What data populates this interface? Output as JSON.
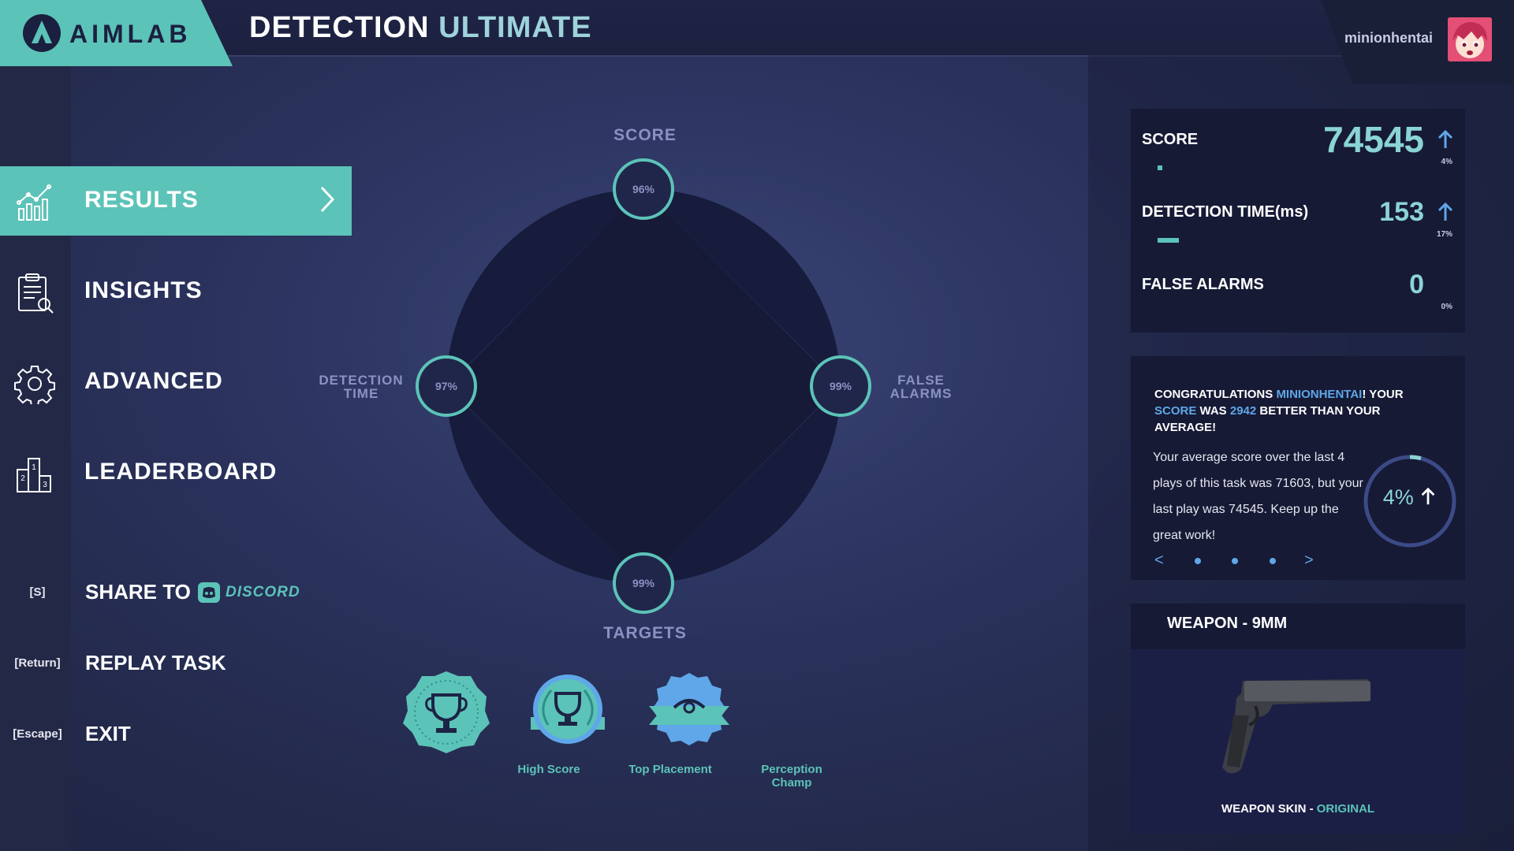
{
  "brand": {
    "name": "AIMLAB"
  },
  "title": {
    "main": "DETECTION",
    "accent": "ULTIMATE"
  },
  "user": {
    "name": "minionhentai"
  },
  "nav": [
    {
      "label": "RESULTS",
      "icon": "chart-icon",
      "active": true
    },
    {
      "label": "INSIGHTS",
      "icon": "clipboard-icon",
      "active": false
    },
    {
      "label": "ADVANCED",
      "icon": "gear-icon",
      "active": false
    },
    {
      "label": "LEADERBOARD",
      "icon": "podium-icon",
      "active": false
    }
  ],
  "actions": [
    {
      "key": "[S]",
      "label": "SHARE TO",
      "extra": "DISCORD"
    },
    {
      "key": "[Return]",
      "label": "REPLAY TASK"
    },
    {
      "key": "[Escape]",
      "label": "EXIT"
    }
  ],
  "radar": {
    "axes": [
      {
        "name": "SCORE",
        "pct": "96%",
        "value": 96
      },
      {
        "name": "FALSE ALARMS",
        "pct": "99%",
        "value": 99
      },
      {
        "name": "TARGETS",
        "pct": "99%",
        "value": 99
      },
      {
        "name": "DETECTION TIME",
        "pct": "97%",
        "value": 97
      }
    ],
    "labels": {
      "score": "SCORE",
      "targets": "TARGETS",
      "detection_1": "DETECTION",
      "detection_2": "TIME",
      "false_1": "FALSE",
      "false_2": "ALARMS"
    }
  },
  "badges": [
    {
      "label": "High Score",
      "icon": "trophy-icon"
    },
    {
      "label": "Top Placement",
      "icon": "trophy-wreath-icon"
    },
    {
      "label": "Perception Champ",
      "icon": "eye-icon"
    }
  ],
  "stats": [
    {
      "label": "SCORE",
      "value": "74545",
      "pct": "4%",
      "bar_fraction": 0.04
    },
    {
      "label": "DETECTION TIME(ms)",
      "value": "153",
      "pct": "17%",
      "bar_fraction": 0.17
    },
    {
      "label": "FALSE ALARMS",
      "value": "0",
      "pct": "0%",
      "bar_fraction": 0
    }
  ],
  "congrats": {
    "c1": "CONGRATULATIONS ",
    "name": "MINIONHENTAI",
    "c2": "!",
    "c3": " YOUR ",
    "score_word": "SCORE",
    "c4": " WAS ",
    "diff": "2942",
    "c5": " BETTER THAN YOUR AVERAGE!",
    "body": "Your average score over the last 4 plays of this task was 71603, but your last play was 74545. Keep up the great work!",
    "ring": "4%",
    "ring_fraction": 0.04,
    "prev": "<",
    "next": ">"
  },
  "weapon": {
    "title": "WEAPON - 9MM",
    "skin_label": "WEAPON SKIN - ",
    "skin_value": "ORIGINAL"
  },
  "colors": {
    "accent": "#5cc3b8",
    "highlight": "#5fa7e8",
    "panel": "#161a35"
  }
}
